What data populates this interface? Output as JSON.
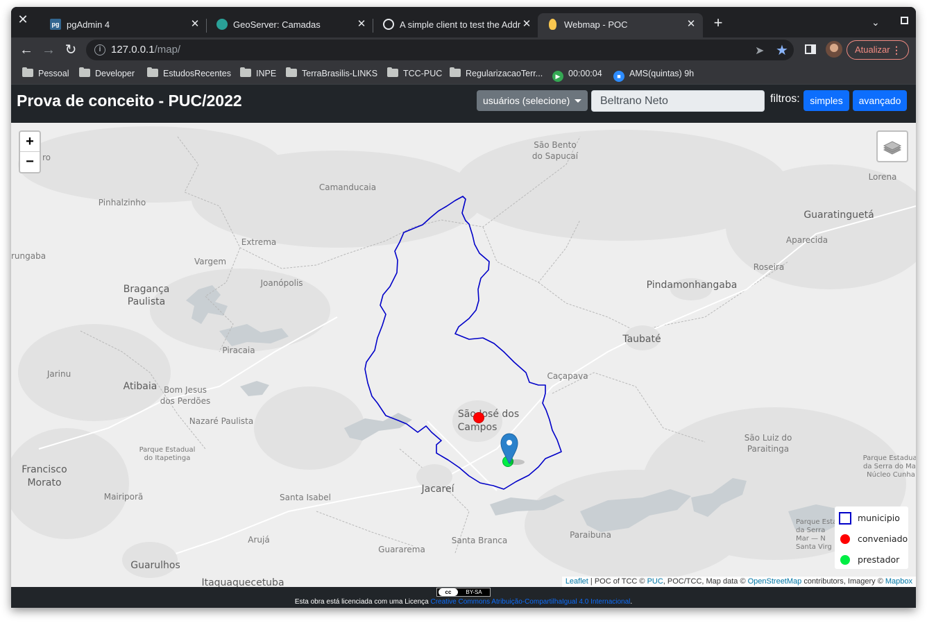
{
  "browser": {
    "tabs": [
      {
        "title": "pgAdmin 4",
        "favicon": "pgadmin-icon",
        "active": false
      },
      {
        "title": "GeoServer: Camadas",
        "favicon": "geoserver-icon",
        "active": false
      },
      {
        "title": "A simple client to test the Addre",
        "favicon": "globe-icon",
        "active": false
      },
      {
        "title": "Webmap - POC",
        "favicon": "lightbulb-icon",
        "active": true
      }
    ],
    "url_host": "127.0.0.1",
    "url_path": "/map/",
    "update_label": "Atualizar",
    "bookmarks": [
      {
        "label": "Pessoal",
        "type": "folder"
      },
      {
        "label": "Developer",
        "type": "folder"
      },
      {
        "label": "EstudosRecentes",
        "type": "folder"
      },
      {
        "label": "INPE",
        "type": "folder"
      },
      {
        "label": "TerraBrasilis-LINKS",
        "type": "folder"
      },
      {
        "label": "TCC-PUC",
        "type": "folder"
      },
      {
        "label": "RegularizacaoTerr...",
        "type": "folder"
      },
      {
        "label": "00:00:04",
        "type": "timer"
      },
      {
        "label": "AMS(quintas) 9h",
        "type": "meeting"
      }
    ]
  },
  "app": {
    "title": "Prova de conceito - PUC/2022",
    "user_select_label": "usuários (selecione)",
    "user_name": "Beltrano Neto",
    "filters_label": "filtros:",
    "filter_simple": "simples",
    "filter_advanced": "avançado"
  },
  "map": {
    "zoom_in": "+",
    "zoom_out": "−",
    "places": {
      "sao_jose": "São José dos",
      "campos": "Campos",
      "jacarei": "Jacareí",
      "taubate": "Taubaté",
      "pinda": "Pindamonhangaba",
      "guaratingueta": "Guaratinguetá",
      "braganca": "Bragança",
      "paulista": "Paulista",
      "atibaia": "Atibaia",
      "francisco": "Francisco",
      "morato": "Morato",
      "guarulhos": "Guarulhos",
      "itaqua": "Itaquaquecetuba",
      "camanducaia": "Camanducaia",
      "pinhalzinho": "Pinhalzinho",
      "extrema": "Extrema",
      "vargem": "Vargem",
      "joanopolis": "Joanópolis",
      "piracaia": "Piracaia",
      "jarinu": "Jarinu",
      "bomjesus1": "Bom Jesus",
      "bomjesus2": "dos Perdões",
      "nazare": "Nazaré Paulista",
      "pe_itap1": "Parque Estadual",
      "pe_itap2": "do Itapetinga",
      "mairipora": "Mairiporã",
      "santaisabel": "Santa Isabel",
      "aruja": "Arujá",
      "guararema": "Guararema",
      "santabranca": "Santa Branca",
      "paraibuna": "Paraibuna",
      "caçapava": "Caçapava",
      "saobento1": "São Bento",
      "saobento2": "do Sapucaí",
      "lorena": "Lorena",
      "aparecida": "Aparecida",
      "roseira": "Roseira",
      "saoluiz1": "São Luiz do",
      "saoluiz2": "Paraitinga",
      "psm1": "Parque Estadual",
      "psm2": "da Serra do Mar",
      "psm3": "Núcleo Cunha",
      "psm4": "Parque Esta",
      "psm5": "da Serra",
      "psm6": "Mar — N",
      "psm7": "Santa Virg",
      "rungaba": "rungaba",
      "ro": "ro"
    },
    "legend": [
      {
        "label": "municipio",
        "symbol": "square",
        "color": "#0000c8"
      },
      {
        "label": "conveniado",
        "symbol": "circle",
        "color": "#ff0000"
      },
      {
        "label": "prestador",
        "symbol": "circle",
        "color": "#00ee44"
      }
    ],
    "attribution": {
      "leaflet": "Leaflet",
      "text1": " | POC of TCC © ",
      "puc": "PUC",
      "text2": ", POC/TCC, Map data © ",
      "osm": "OpenStreetMap",
      "text3": " contributors, Imagery © ",
      "mapbox": "Mapbox"
    }
  },
  "footer": {
    "cc_left": "cc",
    "cc_right": "BY-SA",
    "license_text": "Esta obra está licenciada com uma Licença ",
    "license_link": "Creative Commons Atribuição-CompartilhaIgual 4.0 Internacional",
    "license_end": "."
  }
}
